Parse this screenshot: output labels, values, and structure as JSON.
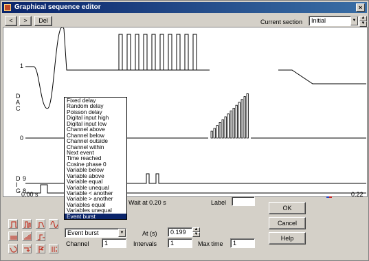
{
  "window": {
    "title": "Graphical sequence editor",
    "close_glyph": "×"
  },
  "toolbar": {
    "prev_label": "<",
    "next_label": ">",
    "del_label": "Del"
  },
  "section": {
    "label": "Current section",
    "value": "Initial"
  },
  "plot": {
    "dac_label_1": "1",
    "dac_letters": [
      "D",
      "A",
      "C"
    ],
    "dac_label_0": "0",
    "dig_letters": [
      "D",
      "I",
      "G"
    ],
    "dig_label_9": "9",
    "dig_label_8": "8",
    "time_start": "0.00 s",
    "time_end": "0.22"
  },
  "dropdown": {
    "items": [
      "Fixed delay",
      "Random delay",
      "Poisson delay",
      "Digital input high",
      "Digital input low",
      "Channel above",
      "Channel below",
      "Channel outside",
      "Channel within",
      "Next event",
      "Time reached",
      "Cosine phase 0",
      "Variable below",
      "Variable above",
      "Variable equal",
      "Variable unequal",
      "Variable < another",
      "Variable > another",
      "Variables equal",
      "Variables unequal",
      "Event burst"
    ],
    "selected_index": 20
  },
  "form": {
    "wait_text": "Wait at 0.20 s",
    "label_caption": "Label",
    "label_value": "",
    "event_select": "Event burst",
    "at_caption": "At (s)",
    "at_value": "0.199",
    "channel_caption": "Channel",
    "channel_value": "1",
    "intervals_caption": "Intervals",
    "intervals_value": "1",
    "maxtime_caption": "Max time",
    "maxtime_value": "1"
  },
  "buttons": {
    "ok": "OK",
    "cancel": "Cancel",
    "help": "Help"
  },
  "tools": [
    "pulse-icon",
    "pulse-train-icon",
    "ramp-pulse-icon",
    "sine-icon",
    "burst-icon",
    "rising-bars-icon",
    "step-icon",
    "loop-icon",
    "jump-icon",
    "flag-icon",
    "sequence-icon"
  ],
  "colors": {
    "title_start": "#0a246a",
    "title_end": "#3a6ea5",
    "selection": "#0a246a",
    "tool_icon": "#c0392b",
    "marker_blue": "#2040c0",
    "marker_red": "#c02020"
  }
}
